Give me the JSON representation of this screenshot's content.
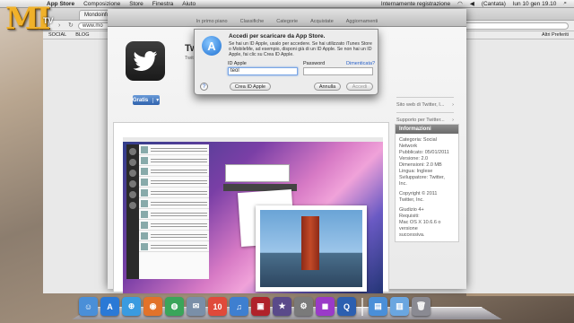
{
  "overlay_logo": {
    "text_main": "MI",
    "text_sub": "TV"
  },
  "menubar": {
    "items": [
      "App Store",
      "Composizione",
      "Store",
      "Finestra",
      "Aiuto"
    ],
    "status": "Internamente registrazione",
    "status_mode": "(Cantata)",
    "clock": "lun 10 gen 19.10"
  },
  "browser": {
    "tab_title": "Mondoinforma...",
    "url": "www.mo",
    "bookmarks": [
      "SOCIAL",
      "BLOG"
    ],
    "bookmarks_other": "Altri Preferiti"
  },
  "app_store": {
    "toolbar_tabs": [
      "In primo piano",
      "Classifiche",
      "Categorie",
      "Acquistate",
      "Aggiornamenti"
    ],
    "app_title_partial": "Tw",
    "app_sub_partial": "Twit",
    "free_button": "Gratis",
    "side_links": [
      "Sito web di Twitter, I...",
      "Supporto per Twitter..."
    ],
    "info": {
      "heading": "Informazioni",
      "lines": [
        "Categoria: Social",
        "Network",
        "Pubblicato: 05/01/2011",
        "Versione: 2.0",
        "Dimensioni: 2.0 MB",
        "Lingua: Inglese",
        "Sviluppatore: Twitter,",
        "Inc.",
        "",
        "Copyright © 2011",
        "Twitter, Inc.",
        "",
        "Giudizio 4+",
        "Requisiti:",
        "Mac OS X 10.6.6 o versione",
        "successiva."
      ]
    }
  },
  "dialog": {
    "title": "Accedi per scaricare da App Store.",
    "body": "Se hai un ID Apple, usalo per accedere. Se hai utilizzato iTunes Store o MobileMe, ad esempio, disponi già di un ID Apple. Se non hai un ID Apple, fai clic su Crea ID Apple.",
    "apple_id_label": "ID Apple",
    "apple_id_value": "teol",
    "password_label": "Password",
    "forgot_label": "Dimenticata?",
    "create_button": "Crea ID Apple",
    "cancel_button": "Annulla",
    "signin_button": "Accedi",
    "help_label": "?"
  },
  "dock": {
    "apps": [
      {
        "name": "finder",
        "color": "#4a8fd8",
        "glyph": "☺"
      },
      {
        "name": "app-store",
        "color": "#2a79d6",
        "glyph": "A"
      },
      {
        "name": "safari",
        "color": "#3a9be0",
        "glyph": "⊕"
      },
      {
        "name": "firefox",
        "color": "#e2722a",
        "glyph": "◉"
      },
      {
        "name": "chrome",
        "color": "#3aa55a",
        "glyph": "◍"
      },
      {
        "name": "mail",
        "color": "#7a8fa8",
        "glyph": "✉"
      },
      {
        "name": "ical",
        "color": "#e04a3a",
        "glyph": "10"
      },
      {
        "name": "itunes",
        "color": "#3e7fd0",
        "glyph": "♫"
      },
      {
        "name": "photo-booth",
        "color": "#b0222a",
        "glyph": "▣"
      },
      {
        "name": "imovie",
        "color": "#5a4a8a",
        "glyph": "★"
      },
      {
        "name": "system-preferences",
        "color": "#7a7a7a",
        "glyph": "⚙"
      },
      {
        "name": "dvd",
        "color": "#9a3ac8",
        "glyph": "◼"
      },
      {
        "name": "quicktime",
        "color": "#2c5fb0",
        "glyph": "Q"
      },
      {
        "name": "downloads",
        "color": "#4a8fd8",
        "glyph": "▤"
      },
      {
        "name": "documents",
        "color": "#6aa6e0",
        "glyph": "▥"
      },
      {
        "name": "trash",
        "color": "#8a8a92",
        "glyph": "🗑"
      }
    ]
  }
}
